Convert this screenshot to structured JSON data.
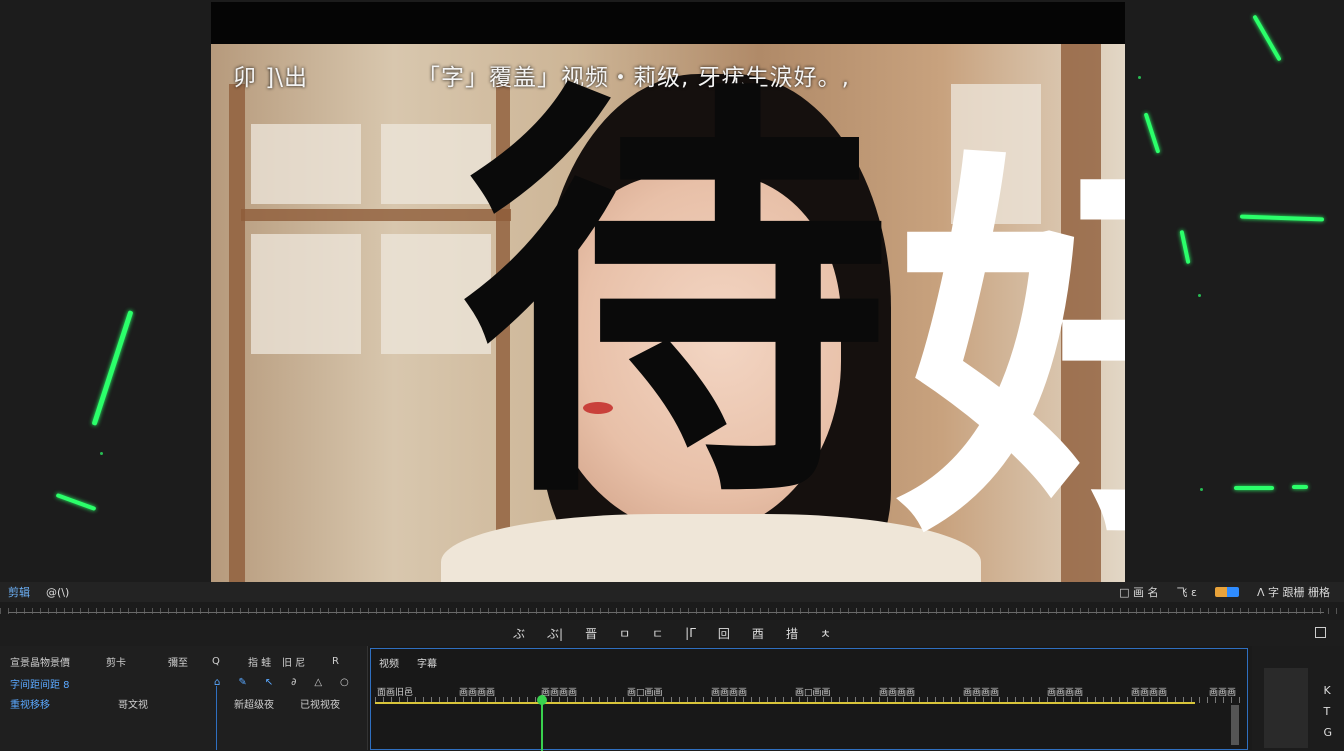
{
  "video": {
    "subtitle_left": "卯 ]\\出",
    "subtitle_right": "「字」覆盖」视频・莉级, 牙疣生涙好。,",
    "big_char_black": "待",
    "big_char_white": "好"
  },
  "colors": {
    "spark": "#2bff6a",
    "accent_blue": "#5aa8ff",
    "playhead": "#39d14e",
    "track": "#d8c53a"
  },
  "topbar": {
    "tab_active": "剪辑",
    "tab_2": "@(\\)",
    "right_1": "□ 画 名",
    "right_2": "飞 ε",
    "right_3": "Λ 字 跟栅 栅格"
  },
  "transport": {
    "items": [
      "ぶ",
      "ぶ|",
      "晋",
      "ㅁ",
      "ㄷ",
      "|Γ",
      "回",
      "酉",
      "措",
      "ㅊ"
    ]
  },
  "left_panel": {
    "row1": [
      "宣景晶物景價",
      "剪卡",
      "彌至",
      "Q",
      "指 蛙",
      "旧 尼",
      "R"
    ],
    "row2_label": "字间距间距 8",
    "row3": [
      "重视移移",
      "哥文视",
      "新超级夜",
      "已视视夜"
    ]
  },
  "timeline": {
    "head": [
      "视频",
      "字幕"
    ],
    "ruler": [
      "面画旧邑",
      "画画画画",
      "画画画画",
      "画□画画",
      "画画画画",
      "画□画画",
      "画画画画",
      "画画画画",
      "画画画画",
      "画画画画",
      "画画画"
    ]
  },
  "right_panel": {
    "icons": [
      "K",
      "T",
      "G"
    ]
  }
}
